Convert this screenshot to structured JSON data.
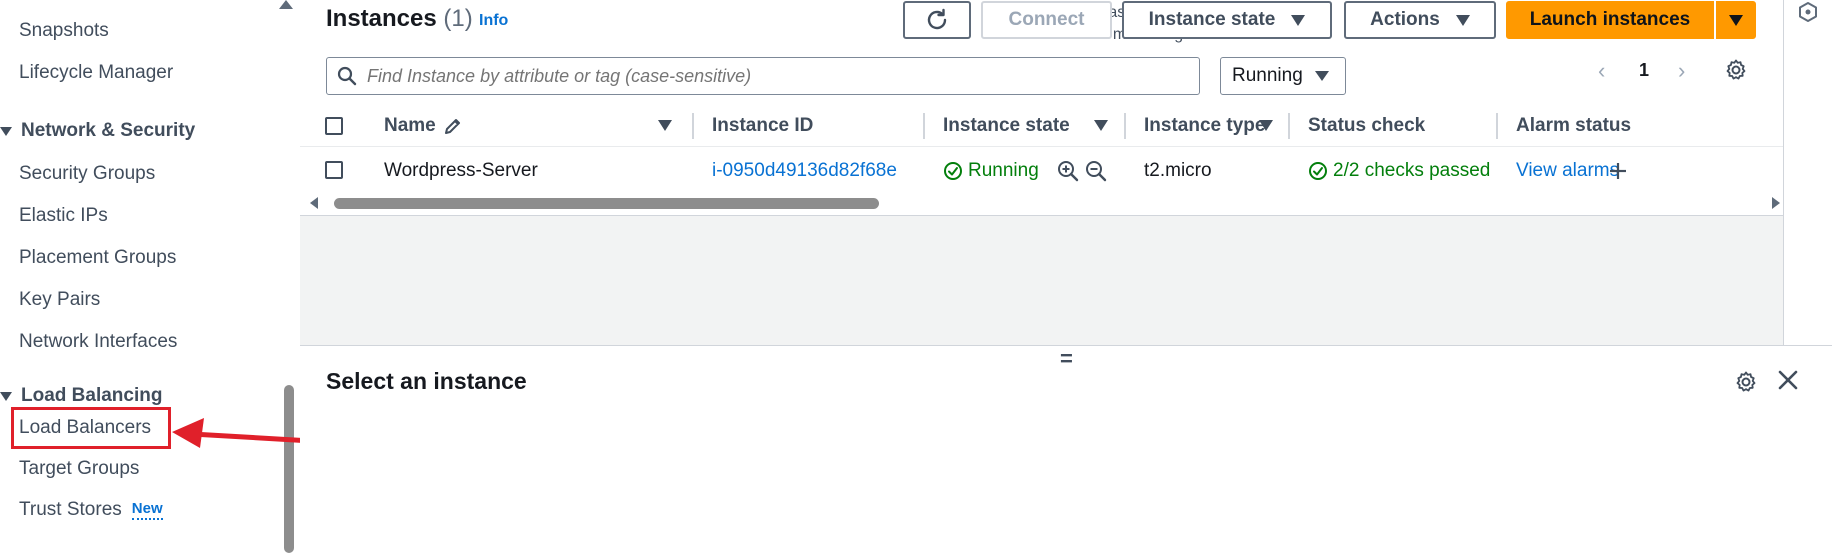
{
  "sidebar": {
    "items_top": [
      {
        "label": "Snapshots"
      },
      {
        "label": "Lifecycle Manager"
      }
    ],
    "network_security": {
      "header": "Network & Security",
      "items": [
        {
          "label": "Security Groups"
        },
        {
          "label": "Elastic IPs"
        },
        {
          "label": "Placement Groups"
        },
        {
          "label": "Key Pairs"
        },
        {
          "label": "Network Interfaces"
        }
      ]
    },
    "load_balancing": {
      "header": "Load Balancing",
      "items": [
        {
          "label": "Load Balancers"
        },
        {
          "label": "Target Groups"
        },
        {
          "label": "Trust Stores",
          "badge": "New"
        }
      ]
    }
  },
  "header": {
    "title": "Instances",
    "count": "(1)",
    "info": "Info",
    "last_updated_line1": "Last updated",
    "last_updated_line2": "less than a minute ago"
  },
  "toolbar": {
    "connect_label": "Connect",
    "instance_state_label": "Instance state",
    "actions_label": "Actions",
    "launch_label": "Launch instances"
  },
  "search": {
    "placeholder": "Find Instance by attribute or tag (case-sensitive)"
  },
  "filter": {
    "selected": "Running"
  },
  "pagination": {
    "prev": "‹",
    "page": "1",
    "next": "›"
  },
  "table": {
    "columns": [
      "Name",
      "Instance ID",
      "Instance state",
      "Instance type",
      "Status check",
      "Alarm status"
    ],
    "rows": [
      {
        "name": "Wordpress-Server",
        "instance_id": "i-0950d49136d82f68e",
        "state": "Running",
        "type": "t2.micro",
        "status_check": "2/2 checks passed",
        "alarm": "View alarms"
      }
    ]
  },
  "details_panel": {
    "title": "Select an instance",
    "handle": "="
  },
  "colors": {
    "accent": "#ff9900",
    "link": "#0972d3",
    "success": "#037f0c",
    "annotation": "#e0202a"
  }
}
